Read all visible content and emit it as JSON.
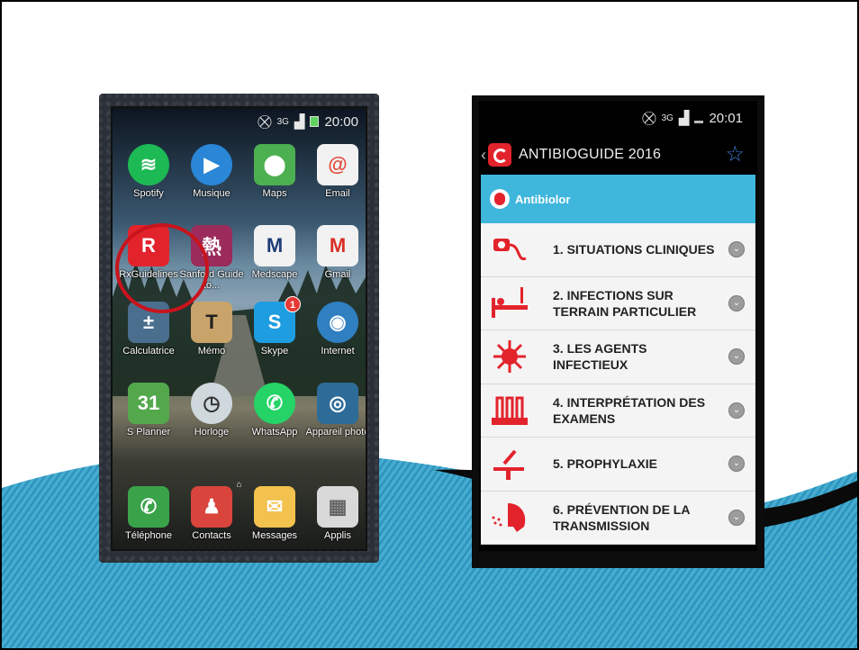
{
  "home_phone": {
    "status": {
      "signal_label": "3G",
      "time": "20:00"
    },
    "apps": [
      {
        "label": "Spotify",
        "icon": "spotify-icon",
        "color": "#1db954"
      },
      {
        "label": "Musique",
        "icon": "music-play-icon",
        "color": "#2a86d6"
      },
      {
        "label": "Maps",
        "icon": "maps-pin-icon",
        "color": "#4caf50"
      },
      {
        "label": "Email",
        "icon": "email-at-icon",
        "color": "#e04c3a"
      },
      {
        "label": "RxGuidelines",
        "icon": "rx-guidelines-logo-icon",
        "color": "#e3232c"
      },
      {
        "label": "Sanford Guide to...",
        "icon": "sanford-guide-icon",
        "color": "#9a2b5a"
      },
      {
        "label": "Medscape",
        "icon": "medscape-icon",
        "color": "#1f3c78"
      },
      {
        "label": "Gmail",
        "icon": "gmail-icon",
        "color": "#d93025"
      },
      {
        "label": "Calculatrice",
        "icon": "calculator-icon",
        "color": "#4a6e8e"
      },
      {
        "label": "Mémo",
        "icon": "memo-t-icon",
        "color": "#c9a46a"
      },
      {
        "label": "Skype",
        "icon": "skype-icon",
        "color": "#1e9de0",
        "badge": "1"
      },
      {
        "label": "Internet",
        "icon": "globe-icon",
        "color": "#2f7fc1"
      },
      {
        "label": "S Planner",
        "icon": "calendar-icon",
        "color": "#53a84c",
        "day": "31"
      },
      {
        "label": "Horloge",
        "icon": "clock-icon",
        "color": "#cfd8dc"
      },
      {
        "label": "WhatsApp",
        "icon": "whatsapp-icon",
        "color": "#25d366"
      },
      {
        "label": "Appareil photo",
        "icon": "camera-icon",
        "color": "#2d6b99"
      }
    ],
    "dock": [
      {
        "label": "Téléphone",
        "icon": "phone-icon",
        "color": "#3aa34a"
      },
      {
        "label": "Contacts",
        "icon": "contacts-icon",
        "color": "#d9443c"
      },
      {
        "label": "Messages",
        "icon": "messages-icon",
        "color": "#f2c14e"
      },
      {
        "label": "Applis",
        "icon": "apps-grid-icon",
        "color": "#d9d9d9"
      }
    ]
  },
  "app_phone": {
    "status": {
      "signal_label": "3G",
      "time": "20:01"
    },
    "title": "ANTIBIOGUIDE 2016",
    "section": "Antibiolor",
    "items": [
      {
        "label": "1. SITUATIONS CLINIQUES",
        "icon": "blood-pressure-icon"
      },
      {
        "label": "2. INFECTIONS SUR TERRAIN PARTICULIER",
        "icon": "hospital-bed-icon"
      },
      {
        "label": "3. LES AGENTS INFECTIEUX",
        "icon": "virus-icon"
      },
      {
        "label": "4. INTERPRÉTATION DES EXAMENS",
        "icon": "test-tubes-icon"
      },
      {
        "label": "5. PROPHYLAXIE",
        "icon": "syringe-table-icon"
      },
      {
        "label": "6. PRÉVENTION DE LA TRANSMISSION",
        "icon": "cough-head-icon"
      }
    ]
  },
  "colors": {
    "accent_red": "#e3232c",
    "section_blue": "#3fb6dc",
    "wave_blue": "#2e9fc4"
  }
}
